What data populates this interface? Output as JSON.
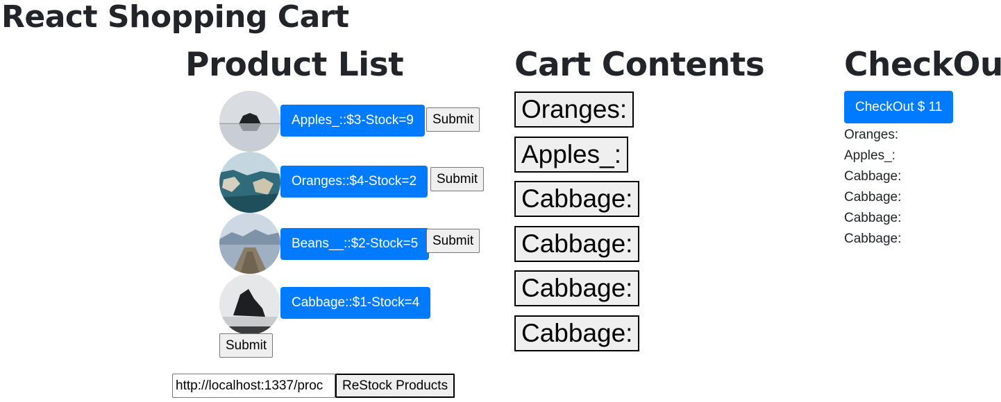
{
  "app_title": "React Shopping Cart",
  "product_list": {
    "heading": "Product List",
    "products": [
      {
        "label": "Apples_::$3-Stock=9",
        "submit_label": "Submit"
      },
      {
        "label": "Oranges::$4-Stock=2",
        "submit_label": "Submit"
      },
      {
        "label": "Beans__::$2-Stock=5",
        "submit_label": "Submit"
      },
      {
        "label": "Cabbage::$1-Stock=4",
        "submit_label": "Submit"
      }
    ],
    "restock_url_value": "http://localhost:1337/proc",
    "restock_label": "ReStock Products"
  },
  "cart": {
    "heading": "Cart Contents",
    "items": [
      "Oranges:",
      "Apples_:",
      "Cabbage:",
      "Cabbage:",
      "Cabbage:",
      "Cabbage:"
    ]
  },
  "checkout": {
    "heading": "CheckOut",
    "button_label": "CheckOut $ 11",
    "items": [
      "Oranges:",
      "Apples_:",
      "Cabbage:",
      "Cabbage:",
      "Cabbage:",
      "Cabbage:"
    ]
  },
  "colors": {
    "primary": "#007bff",
    "text": "#212529"
  }
}
